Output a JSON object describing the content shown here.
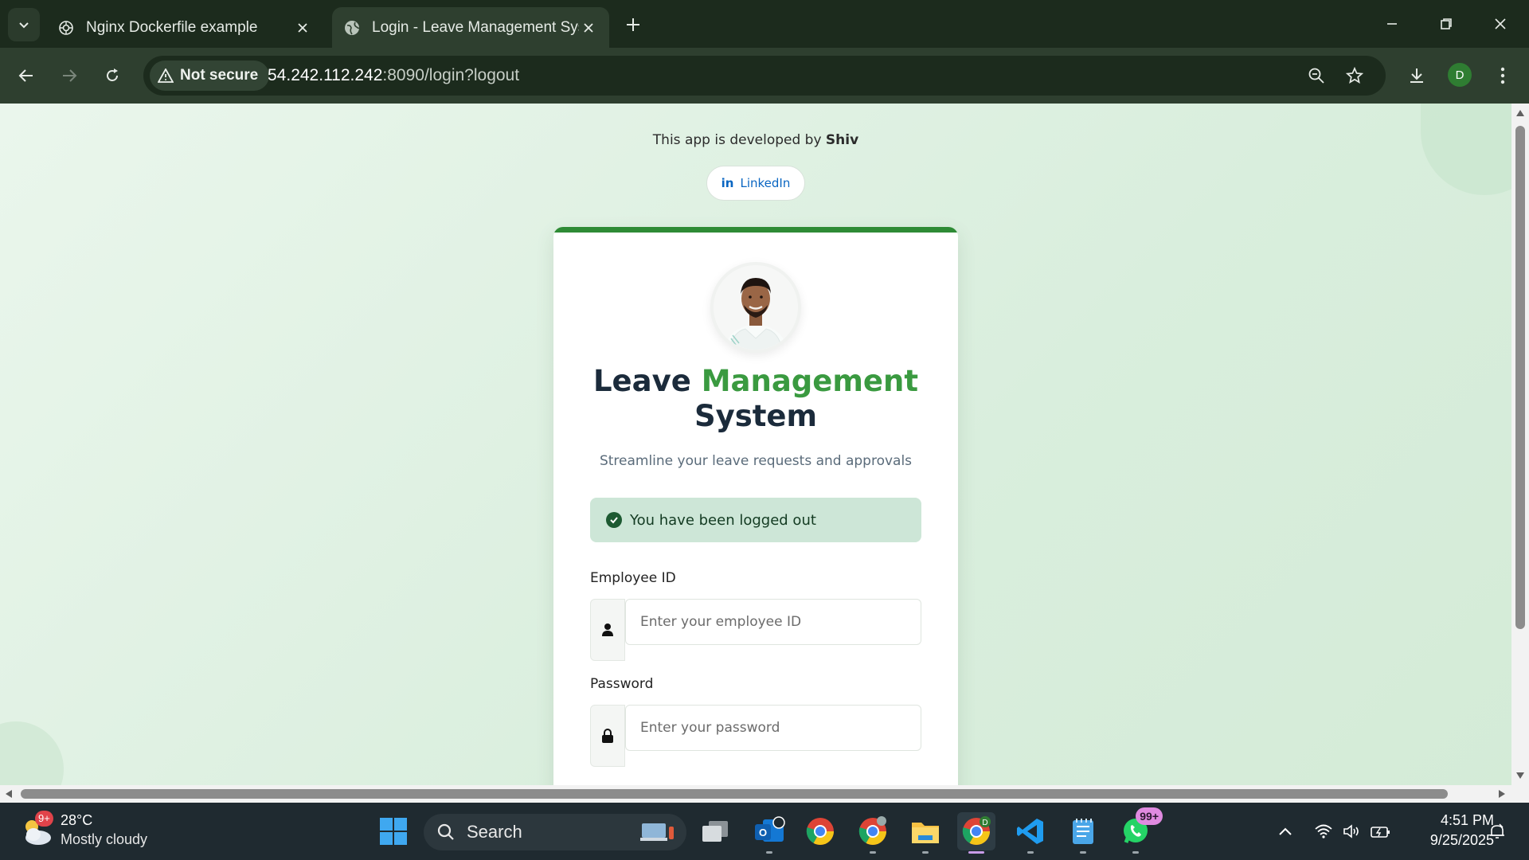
{
  "browser": {
    "tabs": [
      {
        "title": "Nginx Dockerfile example",
        "active": false
      },
      {
        "title": "Login - Leave Management System",
        "active": true
      }
    ],
    "security_label": "Not secure",
    "url_host": "54.242.112.242",
    "url_rest": ":8090/login?logout",
    "profile_initial": "D"
  },
  "page": {
    "developer_prefix": "This app is developed by ",
    "developer_name": "Shiv",
    "linkedin_label": "LinkedIn",
    "title_part1": "Leave ",
    "title_part2": "Management",
    "title_part3": "System",
    "subtitle": "Streamline your leave requests and approvals",
    "alert_message": "You have been logged out",
    "employee_id_label": "Employee ID",
    "employee_id_placeholder": "Enter your employee ID",
    "password_label": "Password",
    "password_placeholder": "Enter your password",
    "accent_color": "#3a9a40"
  },
  "taskbar": {
    "weather_badge": "9+",
    "temperature": "28°C",
    "weather_desc": "Mostly cloudy",
    "search_label": "Search",
    "whatsapp_badge": "99+",
    "chrome_profile_badge": "D",
    "time": "4:51 PM",
    "date": "9/25/2025"
  }
}
